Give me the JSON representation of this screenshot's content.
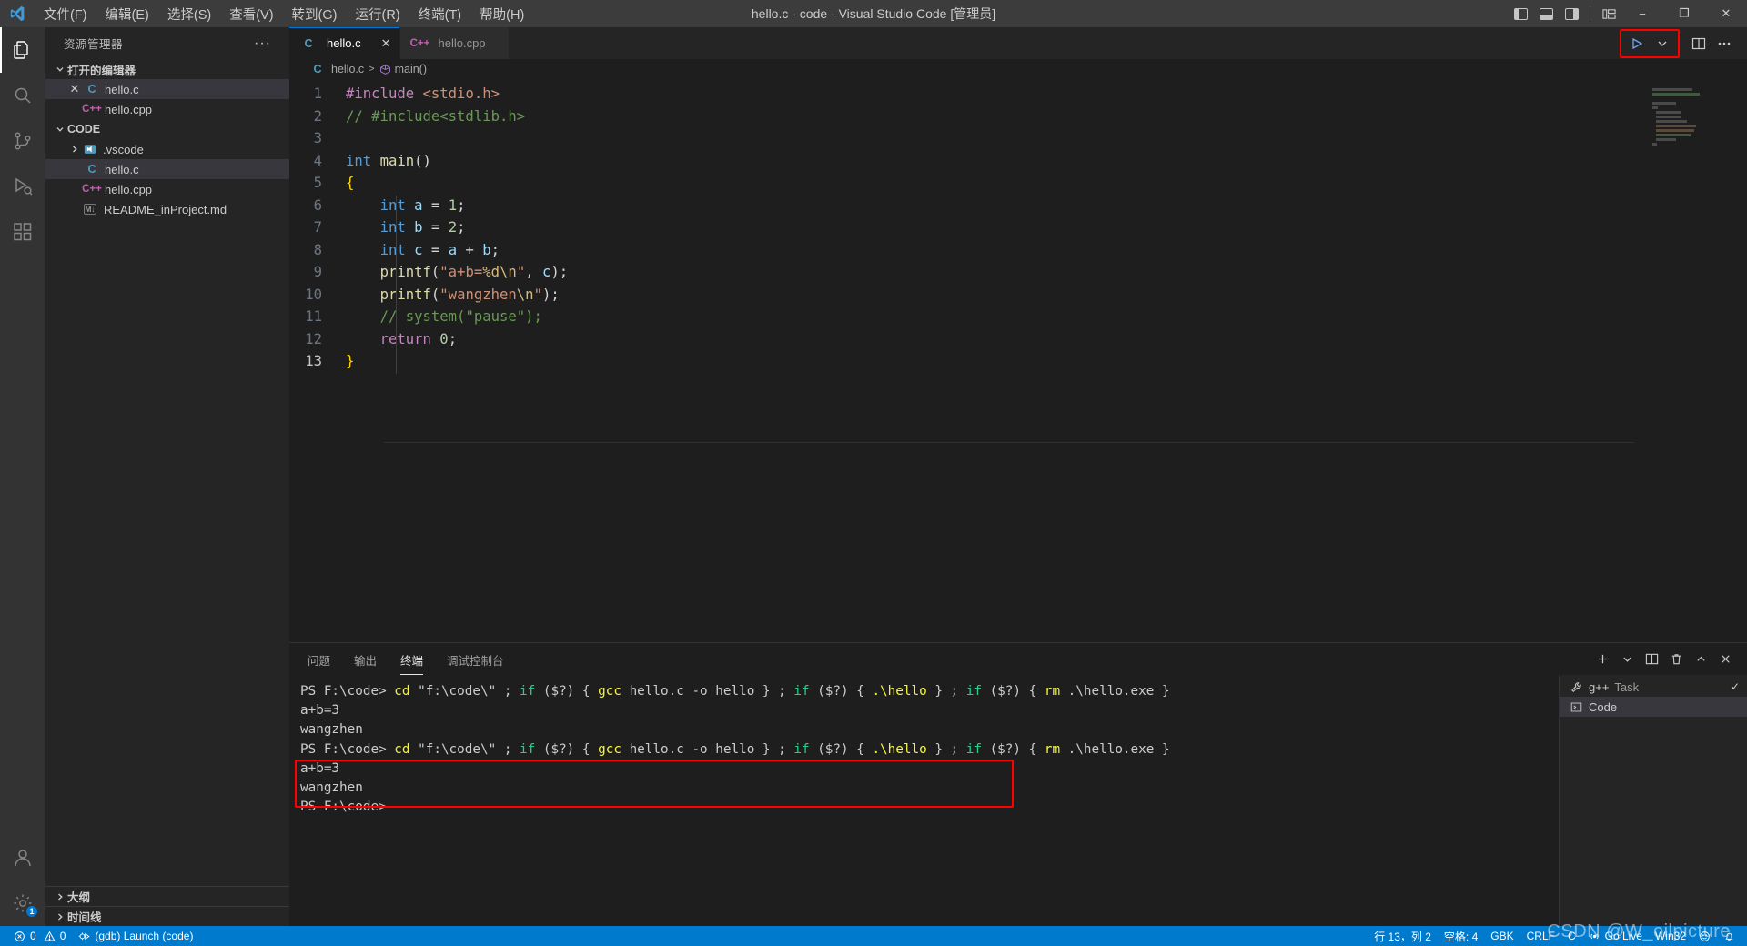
{
  "titlebar": {
    "title": "hello.c - code - Visual Studio Code [管理员]",
    "menu": [
      "文件(F)",
      "编辑(E)",
      "选择(S)",
      "查看(V)",
      "转到(G)",
      "运行(R)",
      "终端(T)",
      "帮助(H)"
    ],
    "layout_icons": [
      "toggle-primary-sidebar-icon",
      "toggle-panel-icon",
      "toggle-secondary-sidebar-icon",
      "customize-layout-icon"
    ],
    "window_controls": {
      "minimize": "−",
      "maximize": "❐",
      "close": "✕"
    }
  },
  "activitybar": {
    "items": [
      {
        "name": "explorer",
        "icon": "files-icon",
        "active": true
      },
      {
        "name": "search",
        "icon": "search-icon",
        "active": false
      },
      {
        "name": "source-control",
        "icon": "source-control-icon",
        "active": false
      },
      {
        "name": "run-and-debug",
        "icon": "run-debug-icon",
        "active": false
      },
      {
        "name": "extensions",
        "icon": "extensions-icon",
        "active": false
      }
    ],
    "bottom": [
      {
        "name": "accounts",
        "icon": "account-icon",
        "badge": ""
      },
      {
        "name": "manage",
        "icon": "gear-icon",
        "badge": "1"
      }
    ]
  },
  "sidebar": {
    "title": "资源管理器",
    "more_label": "···",
    "open_editors": {
      "label": "打开的编辑器",
      "items": [
        {
          "label": "hello.c",
          "icon": "c-file-icon",
          "icon_text": "C",
          "selected": true,
          "has_close": true
        },
        {
          "label": "hello.cpp",
          "icon": "cpp-file-icon",
          "icon_text": "C++",
          "selected": false,
          "has_close": false
        }
      ]
    },
    "folder": {
      "label": "CODE",
      "items": [
        {
          "label": ".vscode",
          "icon": "vscode-folder-icon",
          "icon_text": "▤",
          "type": "folder",
          "selected": false
        },
        {
          "label": "hello.c",
          "icon": "c-file-icon",
          "icon_text": "C",
          "type": "file",
          "selected": true
        },
        {
          "label": "hello.cpp",
          "icon": "cpp-file-icon",
          "icon_text": "C++",
          "type": "file",
          "selected": false
        },
        {
          "label": "README_inProject.md",
          "icon": "markdown-file-icon",
          "icon_text": "M↓",
          "type": "file",
          "selected": false
        }
      ]
    },
    "bottom_sections": [
      {
        "label": "大纲"
      },
      {
        "label": "时间线"
      }
    ]
  },
  "editor": {
    "tabs": [
      {
        "label": "hello.c",
        "icon_text": "C",
        "icon": "c-file-icon",
        "active": true,
        "close": "✕"
      },
      {
        "label": "hello.cpp",
        "icon_text": "C++",
        "icon": "cpp-file-icon",
        "active": false,
        "close": ""
      }
    ],
    "actions": {
      "run_icon": "run-play-icon",
      "run_dropdown_icon": "chevron-down-icon",
      "split_editor_icon": "split-editor-icon",
      "more_actions_icon": "ellipsis-icon",
      "highlight_color": "#ff0000"
    },
    "breadcrumb": {
      "file": "hello.c",
      "separator": ">",
      "symbol": "main()",
      "symbol_icon": "function-symbol-icon"
    },
    "code_lines": [
      {
        "num": "1",
        "text": "#include <stdio.h>"
      },
      {
        "num": "2",
        "text": "// #include<stdlib.h>"
      },
      {
        "num": "3",
        "text": ""
      },
      {
        "num": "4",
        "text": "int main()"
      },
      {
        "num": "5",
        "text": "{"
      },
      {
        "num": "6",
        "text": "    int a = 1;"
      },
      {
        "num": "7",
        "text": "    int b = 2;"
      },
      {
        "num": "8",
        "text": "    int c = a + b;"
      },
      {
        "num": "9",
        "text": "    printf(\"a+b=%d\\n\", c);"
      },
      {
        "num": "10",
        "text": "    printf(\"wangzhen\\n\");"
      },
      {
        "num": "11",
        "text": "    // system(\"pause\");"
      },
      {
        "num": "12",
        "text": "    return 0;"
      },
      {
        "num": "13",
        "text": "}"
      }
    ]
  },
  "panel": {
    "tabs": [
      {
        "label": "问题",
        "active": false
      },
      {
        "label": "输出",
        "active": false
      },
      {
        "label": "终端",
        "active": true
      },
      {
        "label": "调试控制台",
        "active": false
      }
    ],
    "actions": {
      "new_terminal_icon": "plus-icon",
      "terminal_dropdown_icon": "chevron-down-icon",
      "split_terminal_icon": "split-icon",
      "kill_terminal_icon": "trash-icon",
      "maximize_panel_icon": "chevron-up-icon",
      "close_panel_icon": "close-icon"
    },
    "terminal": {
      "lines": [
        {
          "id": "cmd1",
          "segments": [
            {
              "t": "PS F:\\code> ",
              "c": "white"
            },
            {
              "t": "cd ",
              "c": "yellow"
            },
            {
              "t": "\"f:\\code\\\" ",
              "c": "white"
            },
            {
              "t": "; ",
              "c": "white"
            },
            {
              "t": "if ",
              "c": "green"
            },
            {
              "t": "($?) { ",
              "c": "white"
            },
            {
              "t": "gcc ",
              "c": "yellow"
            },
            {
              "t": "hello.c ",
              "c": "white"
            },
            {
              "t": "-o ",
              "c": "gray"
            },
            {
              "t": "hello } ; ",
              "c": "white"
            },
            {
              "t": "if ",
              "c": "green"
            },
            {
              "t": "($?) { ",
              "c": "white"
            },
            {
              "t": ".\\hello ",
              "c": "yellow"
            },
            {
              "t": "} ; ",
              "c": "white"
            },
            {
              "t": "if ",
              "c": "green"
            },
            {
              "t": "($?) { ",
              "c": "white"
            },
            {
              "t": "rm ",
              "c": "yellow"
            },
            {
              "t": ".\\hello.exe }",
              "c": "white"
            }
          ]
        },
        {
          "id": "out1",
          "segments": [
            {
              "t": "a+b=3",
              "c": "white"
            }
          ]
        },
        {
          "id": "out2",
          "segments": [
            {
              "t": "wangzhen",
              "c": "white"
            }
          ]
        },
        {
          "id": "cmd2",
          "segments": [
            {
              "t": "PS F:\\code> ",
              "c": "white"
            },
            {
              "t": "cd ",
              "c": "yellow"
            },
            {
              "t": "\"f:\\code\\\" ",
              "c": "white"
            },
            {
              "t": "; ",
              "c": "white"
            },
            {
              "t": "if ",
              "c": "green"
            },
            {
              "t": "($?) { ",
              "c": "white"
            },
            {
              "t": "gcc ",
              "c": "yellow"
            },
            {
              "t": "hello.c ",
              "c": "white"
            },
            {
              "t": "-o ",
              "c": "gray"
            },
            {
              "t": "hello } ; ",
              "c": "white"
            },
            {
              "t": "if ",
              "c": "green"
            },
            {
              "t": "($?) { ",
              "c": "white"
            },
            {
              "t": ".\\hello ",
              "c": "yellow"
            },
            {
              "t": "} ; ",
              "c": "white"
            },
            {
              "t": "if ",
              "c": "green"
            },
            {
              "t": "($?) { ",
              "c": "white"
            },
            {
              "t": "rm ",
              "c": "yellow"
            },
            {
              "t": ".\\hello.exe }",
              "c": "white"
            }
          ]
        },
        {
          "id": "out3",
          "segments": [
            {
              "t": "a+b=3",
              "c": "white"
            }
          ]
        },
        {
          "id": "out4",
          "segments": [
            {
              "t": "wangzhen",
              "c": "white"
            }
          ]
        },
        {
          "id": "prompt",
          "segments": [
            {
              "t": "PS F:\\code>",
              "c": "white"
            }
          ]
        }
      ],
      "highlight_color": "#ff0000"
    },
    "terminal_list": [
      {
        "label": "g++",
        "sub": "Task",
        "icon": "tools-icon",
        "status": "✓",
        "selected": false
      },
      {
        "label": "Code",
        "sub": "",
        "icon": "terminal-icon",
        "status": "",
        "selected": true
      }
    ]
  },
  "statusbar": {
    "left": [
      {
        "name": "problems",
        "icon": "error-icon",
        "text": "0",
        "icon2": "warning-icon",
        "text2": "0"
      },
      {
        "name": "launch-config",
        "icon": "debug-icon",
        "text": "(gdb) Launch (code)"
      }
    ],
    "right": [
      {
        "name": "cursor-position",
        "text": "行 13，列 2"
      },
      {
        "name": "indentation",
        "text": "空格: 4"
      },
      {
        "name": "encoding",
        "text": "GBK"
      },
      {
        "name": "eol",
        "text": "CRLF"
      },
      {
        "name": "language-mode",
        "text": "C"
      },
      {
        "name": "go-live",
        "text": "Go Live",
        "icon": "broadcast-icon"
      },
      {
        "name": "platform",
        "text": "Win32"
      },
      {
        "name": "feedback",
        "text": "",
        "icon": "smiley-icon"
      },
      {
        "name": "notifications",
        "text": "",
        "icon": "bell-icon"
      }
    ],
    "background": "#007acc"
  },
  "watermark": "CSDN @W_oilpicture"
}
